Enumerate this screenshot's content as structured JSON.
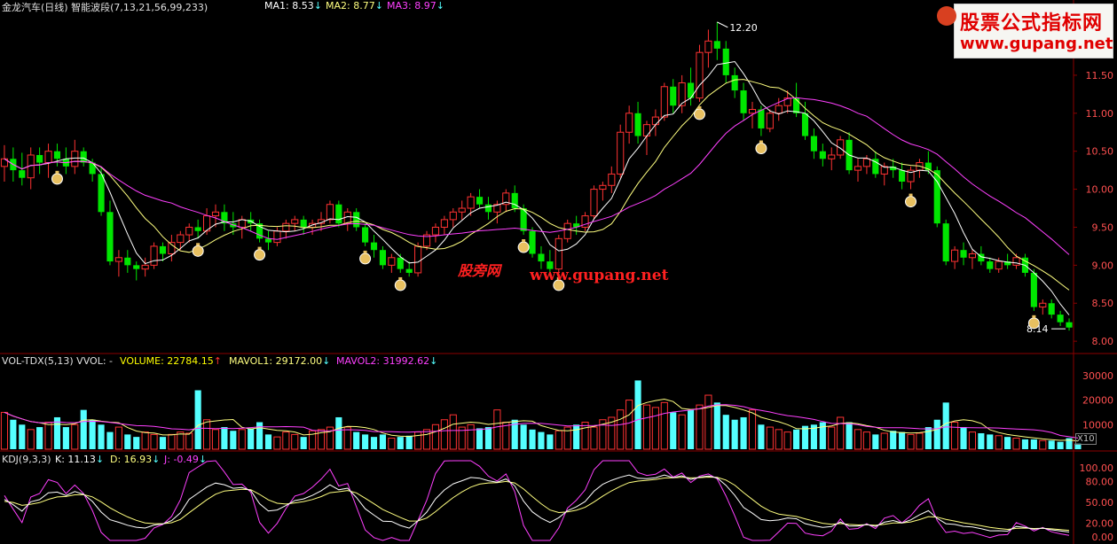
{
  "header": {
    "title": "金龙汽车(日线) 智能波段(7,13,21,56,99,233)",
    "ma1": "MA1: 8.53",
    "ma2": "MA2: 8.77",
    "ma3": "MA3: 8.97"
  },
  "volume_header": {
    "label": "VOL-TDX(5,13)  VVOL: -",
    "volume": "VOLUME: 22784.15",
    "mavol1": "MAVOL1: 29172.00",
    "mavol2": "MAVOL2: 31992.62"
  },
  "kdj_header": {
    "label": "KDJ(9,3,3)",
    "k": "K: 11.13",
    "d": "D: 16.93",
    "j": "J: -0.49"
  },
  "watermark": {
    "line1": "股票公式指标网",
    "line2": "www.gupang.net"
  },
  "overlay": {
    "cn": "股旁网",
    "url": "www.gupang.net"
  },
  "annotations": {
    "high": "12.20",
    "low": "8.14"
  },
  "price_axis": [
    "11.50",
    "11.00",
    "10.50",
    "10.00",
    "9.50",
    "9.00",
    "8.50",
    "8.00"
  ],
  "volume_axis": [
    "30000",
    "20000",
    "10000"
  ],
  "volume_unit": "X10",
  "kdj_axis": [
    "100.00",
    "80.00",
    "50.00",
    "20.00",
    "0.00"
  ],
  "colors": {
    "up": "#ff3232",
    "down": "#00e600",
    "vol_down": "#54ffff",
    "ma1": "#ffffff",
    "ma2": "#ffff80",
    "ma3": "#ff40ff",
    "grid": "#8b0000"
  },
  "chart_data": [
    {
      "type": "candlestick",
      "title": "金龙汽车(日线)",
      "ylim": [
        7.85,
        12.35
      ],
      "candles": [
        [
          10.3,
          10.58,
          10.1,
          10.4
        ],
        [
          10.4,
          10.55,
          10.1,
          10.25
        ],
        [
          10.25,
          10.48,
          10.05,
          10.15
        ],
        [
          10.15,
          10.55,
          10.0,
          10.45
        ],
        [
          10.45,
          10.55,
          10.2,
          10.35
        ],
        [
          10.35,
          10.6,
          10.15,
          10.5
        ],
        [
          10.5,
          10.6,
          10.3,
          10.4
        ],
        [
          10.4,
          10.55,
          10.2,
          10.3
        ],
        [
          10.3,
          10.65,
          10.2,
          10.5
        ],
        [
          10.5,
          10.55,
          10.3,
          10.35
        ],
        [
          10.35,
          10.4,
          10.1,
          10.2
        ],
        [
          10.2,
          10.3,
          9.65,
          9.7
        ],
        [
          9.7,
          9.85,
          9.0,
          9.05
        ],
        [
          9.05,
          9.2,
          8.85,
          9.1
        ],
        [
          9.1,
          9.2,
          8.9,
          9.0
        ],
        [
          9.0,
          9.05,
          8.8,
          8.95
        ],
        [
          8.95,
          9.1,
          8.85,
          9.0
        ],
        [
          9.0,
          9.3,
          8.95,
          9.25
        ],
        [
          9.25,
          9.3,
          9.05,
          9.15
        ],
        [
          9.15,
          9.4,
          9.05,
          9.3
        ],
        [
          9.3,
          9.45,
          9.2,
          9.4
        ],
        [
          9.4,
          9.55,
          9.3,
          9.5
        ],
        [
          9.5,
          9.6,
          9.35,
          9.45
        ],
        [
          9.45,
          9.75,
          9.4,
          9.65
        ],
        [
          9.65,
          9.8,
          9.5,
          9.7
        ],
        [
          9.7,
          9.8,
          9.45,
          9.55
        ],
        [
          9.55,
          9.7,
          9.4,
          9.5
        ],
        [
          9.5,
          9.65,
          9.35,
          9.6
        ],
        [
          9.6,
          9.7,
          9.45,
          9.55
        ],
        [
          9.55,
          9.6,
          9.3,
          9.35
        ],
        [
          9.35,
          9.45,
          9.2,
          9.3
        ],
        [
          9.3,
          9.5,
          9.25,
          9.45
        ],
        [
          9.45,
          9.6,
          9.35,
          9.55
        ],
        [
          9.55,
          9.65,
          9.45,
          9.6
        ],
        [
          9.6,
          9.65,
          9.4,
          9.5
        ],
        [
          9.5,
          9.6,
          9.4,
          9.55
        ],
        [
          9.55,
          9.7,
          9.45,
          9.6
        ],
        [
          9.6,
          9.85,
          9.55,
          9.8
        ],
        [
          9.8,
          9.85,
          9.5,
          9.55
        ],
        [
          9.55,
          9.75,
          9.45,
          9.7
        ],
        [
          9.7,
          9.75,
          9.45,
          9.5
        ],
        [
          9.5,
          9.55,
          9.25,
          9.3
        ],
        [
          9.3,
          9.4,
          9.1,
          9.2
        ],
        [
          9.2,
          9.25,
          8.95,
          9.0
        ],
        [
          9.0,
          9.15,
          8.9,
          9.1
        ],
        [
          9.1,
          9.15,
          8.9,
          8.95
        ],
        [
          8.95,
          9.05,
          8.85,
          8.9
        ],
        [
          8.9,
          9.3,
          8.85,
          9.25
        ],
        [
          9.25,
          9.45,
          9.2,
          9.4
        ],
        [
          9.4,
          9.55,
          9.3,
          9.5
        ],
        [
          9.5,
          9.65,
          9.4,
          9.6
        ],
        [
          9.6,
          9.75,
          9.5,
          9.7
        ],
        [
          9.7,
          9.85,
          9.6,
          9.75
        ],
        [
          9.75,
          9.95,
          9.65,
          9.9
        ],
        [
          9.9,
          10.0,
          9.75,
          9.8
        ],
        [
          9.8,
          9.9,
          9.6,
          9.7
        ],
        [
          9.7,
          9.85,
          9.55,
          9.8
        ],
        [
          9.8,
          10.0,
          9.7,
          9.95
        ],
        [
          9.95,
          10.05,
          9.7,
          9.75
        ],
        [
          9.75,
          9.8,
          9.4,
          9.45
        ],
        [
          9.45,
          9.5,
          9.1,
          9.15
        ],
        [
          9.15,
          9.25,
          8.95,
          9.05
        ],
        [
          9.05,
          9.2,
          8.85,
          8.95
        ],
        [
          8.95,
          9.4,
          8.9,
          9.35
        ],
        [
          9.35,
          9.6,
          9.3,
          9.55
        ],
        [
          9.55,
          9.65,
          9.4,
          9.5
        ],
        [
          9.5,
          9.7,
          9.45,
          9.65
        ],
        [
          9.65,
          10.05,
          9.6,
          10.0
        ],
        [
          10.0,
          10.1,
          9.85,
          10.05
        ],
        [
          10.05,
          10.3,
          9.95,
          10.2
        ],
        [
          10.2,
          10.85,
          10.15,
          10.75
        ],
        [
          10.75,
          11.1,
          10.6,
          11.0
        ],
        [
          11.0,
          11.15,
          10.6,
          10.7
        ],
        [
          10.7,
          10.9,
          10.45,
          10.85
        ],
        [
          10.85,
          11.05,
          10.7,
          10.95
        ],
        [
          10.95,
          11.4,
          10.9,
          11.35
        ],
        [
          11.35,
          11.45,
          11.0,
          11.1
        ],
        [
          11.1,
          11.5,
          11.0,
          11.4
        ],
        [
          11.4,
          11.6,
          11.1,
          11.2
        ],
        [
          11.2,
          11.9,
          11.15,
          11.8
        ],
        [
          11.8,
          12.1,
          11.6,
          11.95
        ],
        [
          11.95,
          12.2,
          11.7,
          11.85
        ],
        [
          11.85,
          11.95,
          11.4,
          11.5
        ],
        [
          11.5,
          11.6,
          11.2,
          11.3
        ],
        [
          11.3,
          11.4,
          10.9,
          11.0
        ],
        [
          11.0,
          11.15,
          10.8,
          11.05
        ],
        [
          11.05,
          11.1,
          10.7,
          10.8
        ],
        [
          10.8,
          11.05,
          10.75,
          11.0
        ],
        [
          11.0,
          11.2,
          10.9,
          11.1
        ],
        [
          11.1,
          11.3,
          11.0,
          11.2
        ],
        [
          11.2,
          11.4,
          10.95,
          11.0
        ],
        [
          11.0,
          11.15,
          10.65,
          10.7
        ],
        [
          10.7,
          10.8,
          10.4,
          10.5
        ],
        [
          10.5,
          10.6,
          10.3,
          10.4
        ],
        [
          10.4,
          10.55,
          10.25,
          10.45
        ],
        [
          10.45,
          10.7,
          10.4,
          10.65
        ],
        [
          10.65,
          10.75,
          10.2,
          10.25
        ],
        [
          10.25,
          10.4,
          10.1,
          10.3
        ],
        [
          10.3,
          10.45,
          10.2,
          10.4
        ],
        [
          10.4,
          10.5,
          10.15,
          10.2
        ],
        [
          10.2,
          10.35,
          10.05,
          10.3
        ],
        [
          10.3,
          10.4,
          10.15,
          10.25
        ],
        [
          10.25,
          10.35,
          10.0,
          10.1
        ],
        [
          10.1,
          10.3,
          10.0,
          10.25
        ],
        [
          10.25,
          10.4,
          10.15,
          10.35
        ],
        [
          10.35,
          10.5,
          10.2,
          10.25
        ],
        [
          10.25,
          10.3,
          9.5,
          9.55
        ],
        [
          9.55,
          9.6,
          9.0,
          9.05
        ],
        [
          9.05,
          9.25,
          8.95,
          9.2
        ],
        [
          9.2,
          9.3,
          9.0,
          9.1
        ],
        [
          9.1,
          9.2,
          8.95,
          9.15
        ],
        [
          9.15,
          9.25,
          9.0,
          9.05
        ],
        [
          9.05,
          9.1,
          8.9,
          8.95
        ],
        [
          8.95,
          9.1,
          8.9,
          9.05
        ],
        [
          9.05,
          9.15,
          8.95,
          9.0
        ],
        [
          9.0,
          9.15,
          8.95,
          9.1
        ],
        [
          9.1,
          9.15,
          8.85,
          8.9
        ],
        [
          8.9,
          8.95,
          8.4,
          8.45
        ],
        [
          8.45,
          8.55,
          8.35,
          8.5
        ],
        [
          8.5,
          8.55,
          8.3,
          8.35
        ],
        [
          8.35,
          8.4,
          8.2,
          8.25
        ],
        [
          8.25,
          8.3,
          8.14,
          8.18
        ]
      ],
      "series": [
        {
          "name": "MA1",
          "values": []
        },
        {
          "name": "MA2",
          "values": []
        },
        {
          "name": "MA3",
          "values": []
        }
      ],
      "annotations": [
        {
          "text": "12.20",
          "kind": "high"
        },
        {
          "text": "8.14",
          "kind": "low"
        }
      ],
      "y_ticks": [
        11.5,
        11.0,
        10.5,
        10.0,
        9.5,
        9.0,
        8.5,
        8.0
      ]
    },
    {
      "type": "bar",
      "title": "VOL-TDX(5,13)",
      "ylim": [
        0,
        35000
      ],
      "values": [
        15000,
        12000,
        10000,
        8000,
        9000,
        11000,
        13000,
        9000,
        10000,
        16000,
        12000,
        10000,
        7000,
        9000,
        6000,
        5000,
        7000,
        6000,
        5000,
        6000,
        7000,
        6500,
        24000,
        12000,
        8000,
        9000,
        7500,
        8000,
        8500,
        11000,
        6000,
        5000,
        7000,
        6000,
        5000,
        7500,
        8000,
        9000,
        13000,
        9000,
        7000,
        6000,
        5000,
        6000,
        4500,
        5000,
        5500,
        7000,
        8000,
        10000,
        12000,
        14000,
        9000,
        10000,
        8500,
        9000,
        16000,
        11000,
        12000,
        10000,
        8000,
        7000,
        6000,
        7500,
        9000,
        10000,
        11000,
        9000,
        12000,
        13000,
        16000,
        20000,
        28000,
        18000,
        17000,
        19000,
        15000,
        14000,
        16000,
        18000,
        22000,
        19000,
        14000,
        12000,
        13000,
        16000,
        10000,
        9000,
        8000,
        7000,
        8000,
        9500,
        10000,
        11000,
        9000,
        13000,
        11000,
        8000,
        7000,
        6000,
        6500,
        7500,
        7000,
        6000,
        6500,
        9000,
        12000,
        19000,
        11000,
        9000,
        7000,
        6500,
        6000,
        5500,
        5000,
        4500,
        4000,
        4000,
        3500,
        3500,
        3000,
        4500,
        2278
      ]
    },
    {
      "type": "line",
      "title": "KDJ(9,3,3)",
      "ylim": [
        -5,
        110
      ],
      "series": [
        {
          "name": "K",
          "values": []
        },
        {
          "name": "D",
          "values": []
        },
        {
          "name": "J",
          "values": []
        }
      ],
      "y_ticks": [
        100,
        80,
        50,
        20,
        0
      ]
    }
  ]
}
